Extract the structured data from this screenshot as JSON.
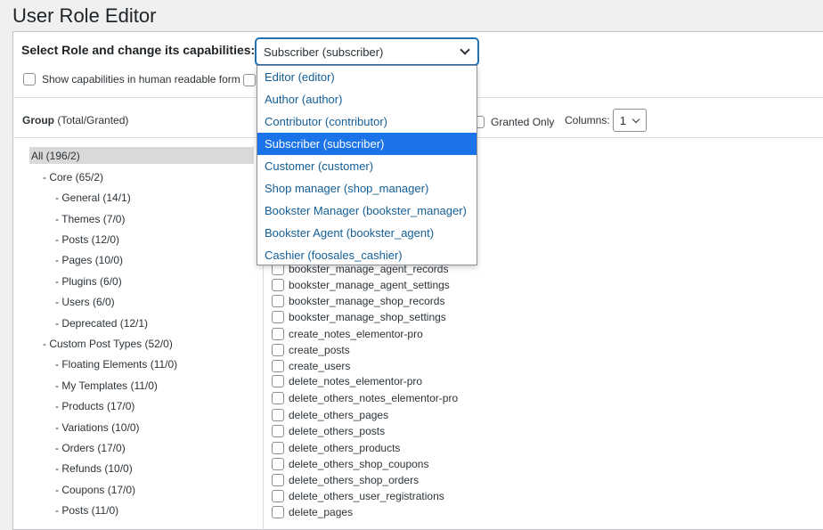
{
  "page_title": "User Role Editor",
  "role_selector": {
    "label": "Select Role and change its capabilities:",
    "selected": "Subscriber (subscriber)",
    "options": [
      "Editor (editor)",
      "Author (author)",
      "Contributor (contributor)",
      "Subscriber (subscriber)",
      "Customer (customer)",
      "Shop manager (shop_manager)",
      "Bookster Manager (bookster_manager)",
      "Bookster Agent (bookster_agent)",
      "Cashier (foosales_cashier)"
    ],
    "selected_index": 3
  },
  "options": {
    "human_readable_label": "Show capabilities in human readable form"
  },
  "group_header": {
    "bold": "Group",
    "normal": "(Total/Granted)"
  },
  "granted_only_label": "Granted Only",
  "columns": {
    "label": "Columns:",
    "value": "1"
  },
  "tree": [
    {
      "label": "All (196/2)"
    },
    {
      "label": "- Core (65/2)"
    },
    {
      "label": "- General (14/1)"
    },
    {
      "label": "- Themes (7/0)"
    },
    {
      "label": "- Posts (12/0)"
    },
    {
      "label": "- Pages (10/0)"
    },
    {
      "label": "- Plugins (6/0)"
    },
    {
      "label": "- Users (6/0)"
    },
    {
      "label": "- Deprecated (12/1)"
    },
    {
      "label": "- Custom Post Types (52/0)"
    },
    {
      "label": "- Floating Elements (11/0)"
    },
    {
      "label": "- My Templates (11/0)"
    },
    {
      "label": "- Products (17/0)"
    },
    {
      "label": "- Variations (10/0)"
    },
    {
      "label": "- Orders (17/0)"
    },
    {
      "label": "- Refunds (10/0)"
    },
    {
      "label": "- Coupons (17/0)"
    },
    {
      "label": "- Posts (11/0)"
    }
  ],
  "capabilities": [
    "bookster_manage_agent_records",
    "bookster_manage_agent_settings",
    "bookster_manage_shop_records",
    "bookster_manage_shop_settings",
    "create_notes_elementor-pro",
    "create_posts",
    "create_users",
    "delete_notes_elementor-pro",
    "delete_others_notes_elementor-pro",
    "delete_others_pages",
    "delete_others_posts",
    "delete_others_products",
    "delete_others_shop_coupons",
    "delete_others_shop_orders",
    "delete_others_user_registrations",
    "delete_pages"
  ],
  "colors": {
    "accent": "#2271b1",
    "selected_option_bg": "#1a73e8",
    "option_text": "#135e96"
  }
}
